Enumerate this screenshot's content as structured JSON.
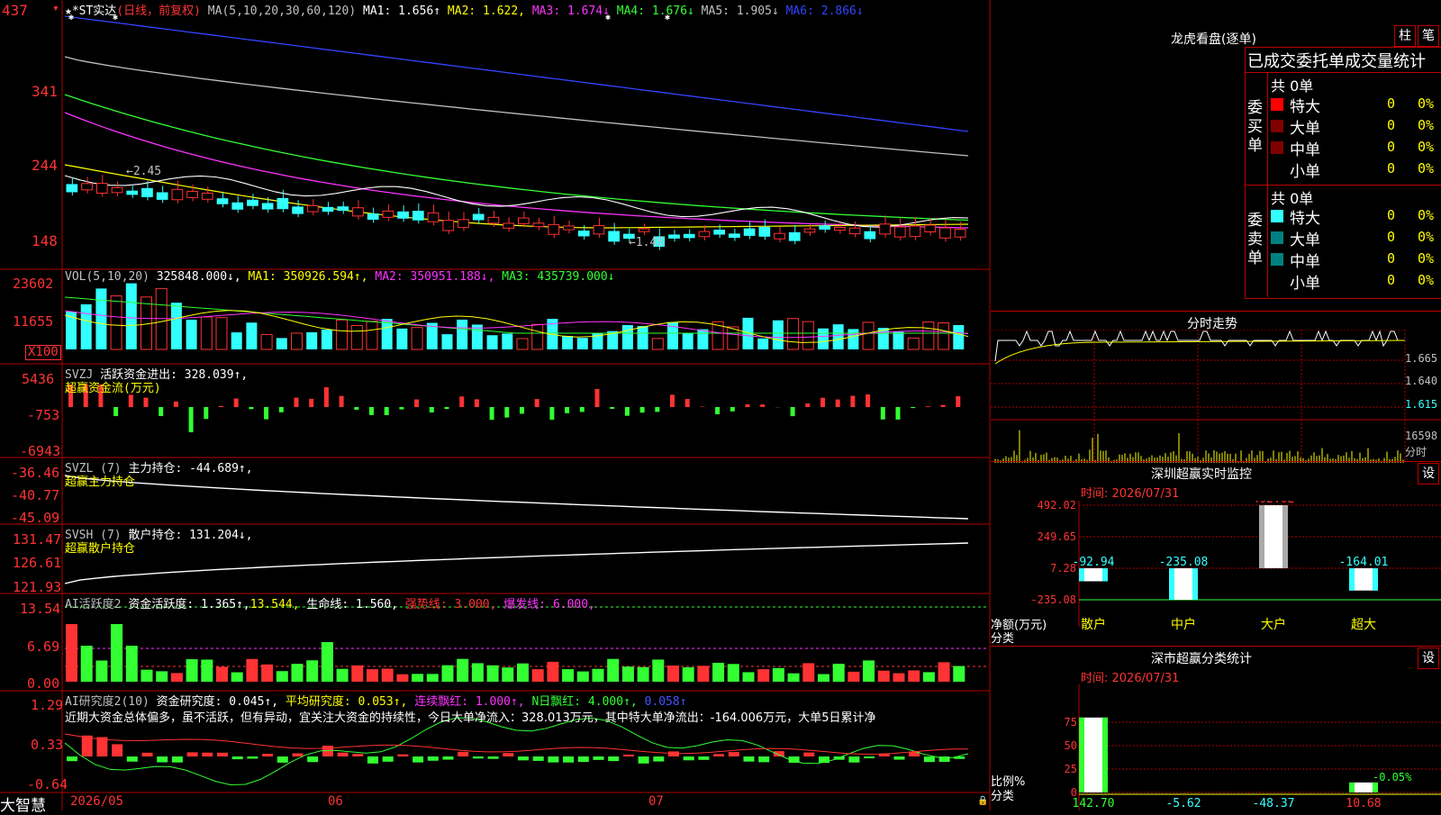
{
  "main_chart": {
    "stock_name": "★*ST实达",
    "period": "(日线，前复权)",
    "ma_label": "MA(5,10,20,30,60,120)",
    "ma_values": [
      {
        "label": "MA1: 1.656↑",
        "color": "#ffffff"
      },
      {
        "label": "MA2: 1.622,",
        "color": "#ffff00"
      },
      {
        "label": "MA3: 1.674↓",
        "color": "#ff33ff"
      },
      {
        "label": "MA4: 1.676↓",
        "color": "#33ff33"
      },
      {
        "label": "MA5: 1.905↓",
        "color": "#c0c0c0"
      },
      {
        "label": "MA6: 2.866↓",
        "color": "#3344ff"
      }
    ],
    "y_ticks": [
      "437",
      "341",
      "244",
      "148"
    ],
    "annot_high": "←2.45",
    "annot_low": "←1.48"
  },
  "vol_panel": {
    "label": "VOL(5,10,20)",
    "value": "325848.000↓,",
    "ma1": "MA1: 350926.594↑,",
    "ma2": "MA2: 350951.188↓,",
    "ma3": "MA3: 435739.000↓",
    "y_ticks": [
      "23602",
      "11655"
    ],
    "unit": "X100"
  },
  "svzj_panel": {
    "label": "SVZJ",
    "desc": "活跃资金进出: 328.039↑,",
    "sub": "超赢资金流(万元)",
    "y_ticks": [
      "5436",
      "-753",
      "-6943"
    ]
  },
  "svzl_panel": {
    "label": "SVZL (7)",
    "desc": "主力持仓: -44.689↑,",
    "sub": "超赢主力持仓",
    "y_ticks": [
      "-36.46",
      "-40.77",
      "-45.09"
    ]
  },
  "svsh_panel": {
    "label": "SVSH (7)",
    "desc": "散户持仓: 131.204↓,",
    "sub": "超赢散户持仓",
    "y_ticks": [
      "131.47",
      "126.61",
      "121.93"
    ]
  },
  "ai1_panel": {
    "label": "AI活跃度2",
    "desc": "资金活跃度: 1.365↑,",
    "v2": "13.544,",
    "life": "生命线: 1.560,",
    "strong": "强势线: 3.000,",
    "burst": "爆发线: 6.000,",
    "y_ticks": [
      "13.54",
      "6.69",
      "0.00"
    ]
  },
  "ai2_panel": {
    "label": "AI研究度2(10)",
    "desc": "资金研究度: 0.045↑,",
    "avg": "平均研究度: 0.053↑,",
    "cont": "连续飘红: 1.000↑,",
    "nday": "N日飘红: 4.000↑,",
    "last": "0.058↑",
    "comment": "近期大资金总体偏多，虽不活跃，但有异动，宜关注大资金的持续性，今日大单净流入：328.013万元，其中特大单净流出：-164.006万元，大单5日累计净",
    "y_ticks": [
      "1.29",
      "0.33",
      "-0.64"
    ]
  },
  "footer": {
    "brand": "大智慧",
    "months": [
      "2026/05",
      "06",
      "07"
    ]
  },
  "side": {
    "title": "龙虎看盘(逐单)",
    "btn1": "柱",
    "btn2": "笔",
    "stats_title": "已成交委托单成交量统计",
    "buy_label": "委买单",
    "sell_label": "委卖单",
    "buy_total": "共 0单",
    "sell_total": "共 0单",
    "rows": [
      {
        "name": "特大",
        "count": "0",
        "pct": "0%"
      },
      {
        "name": "大单",
        "count": "0",
        "pct": "0%"
      },
      {
        "name": "中单",
        "count": "0",
        "pct": "0%"
      },
      {
        "name": "小单",
        "count": "0",
        "pct": "0%"
      }
    ],
    "intraday_title": "分时走势",
    "intraday_ticks": [
      "1.665",
      "1.640",
      "1.615"
    ],
    "intraday_vol": "16598",
    "intraday_vol_label": "分时",
    "monitor_title": "深圳超赢实时监控",
    "monitor_date": "时间: 2026/07/31",
    "monitor_btn": "设",
    "monitor_ticks": [
      "492.02",
      "249.65",
      "7.28",
      "-235.08"
    ],
    "monitor_axis_label": "净额(万元)",
    "monitor_cat_label": "分类",
    "monitor_chart": {
      "type": "bar",
      "categories": [
        "散户",
        "中户",
        "大户",
        "超大"
      ],
      "values": [
        -92.94,
        -235.08,
        492.02,
        -164.01
      ],
      "labels": [
        "-92.94",
        "-235.08",
        "492.02",
        "-164.01"
      ]
    },
    "class_title": "深市超赢分类统计",
    "class_date": "时间: 2026/07/31",
    "class_btn": "设",
    "class_ticks": [
      "75",
      "50",
      "25",
      "0"
    ],
    "class_axis_label": "比例%",
    "class_cat_label": "分类",
    "class_chart": {
      "type": "bar",
      "categories": [
        "散户",
        "中户",
        "大户",
        "超大"
      ],
      "values": [
        142.7,
        -5.62,
        -48.37,
        10.68
      ],
      "labels": [
        "142.70",
        "-5.62",
        "-48.37",
        "10.68"
      ],
      "extra_label": "-0.05%"
    }
  },
  "chart_data": {
    "type": "bar",
    "categories": [
      "散户",
      "中户",
      "大户",
      "超大"
    ],
    "series": [
      {
        "name": "净额(万元)",
        "values": [
          -92.94,
          -235.08,
          492.02,
          -164.01
        ]
      },
      {
        "name": "比例%",
        "values": [
          142.7,
          -5.62,
          -48.37,
          10.68
        ]
      }
    ],
    "main_candles": {
      "y_ticks": [
        437,
        341,
        244,
        148
      ],
      "high_mark": 2.45,
      "low_mark": 1.48,
      "ma": [
        1.656,
        1.622,
        1.674,
        1.676,
        1.905,
        2.866
      ]
    }
  },
  "colors": {
    "up": "#ff3333",
    "down": "#33ffff",
    "grid": "#b00000",
    "yellow": "#ffff00",
    "green": "#33ff33",
    "magenta": "#ff33ff"
  }
}
